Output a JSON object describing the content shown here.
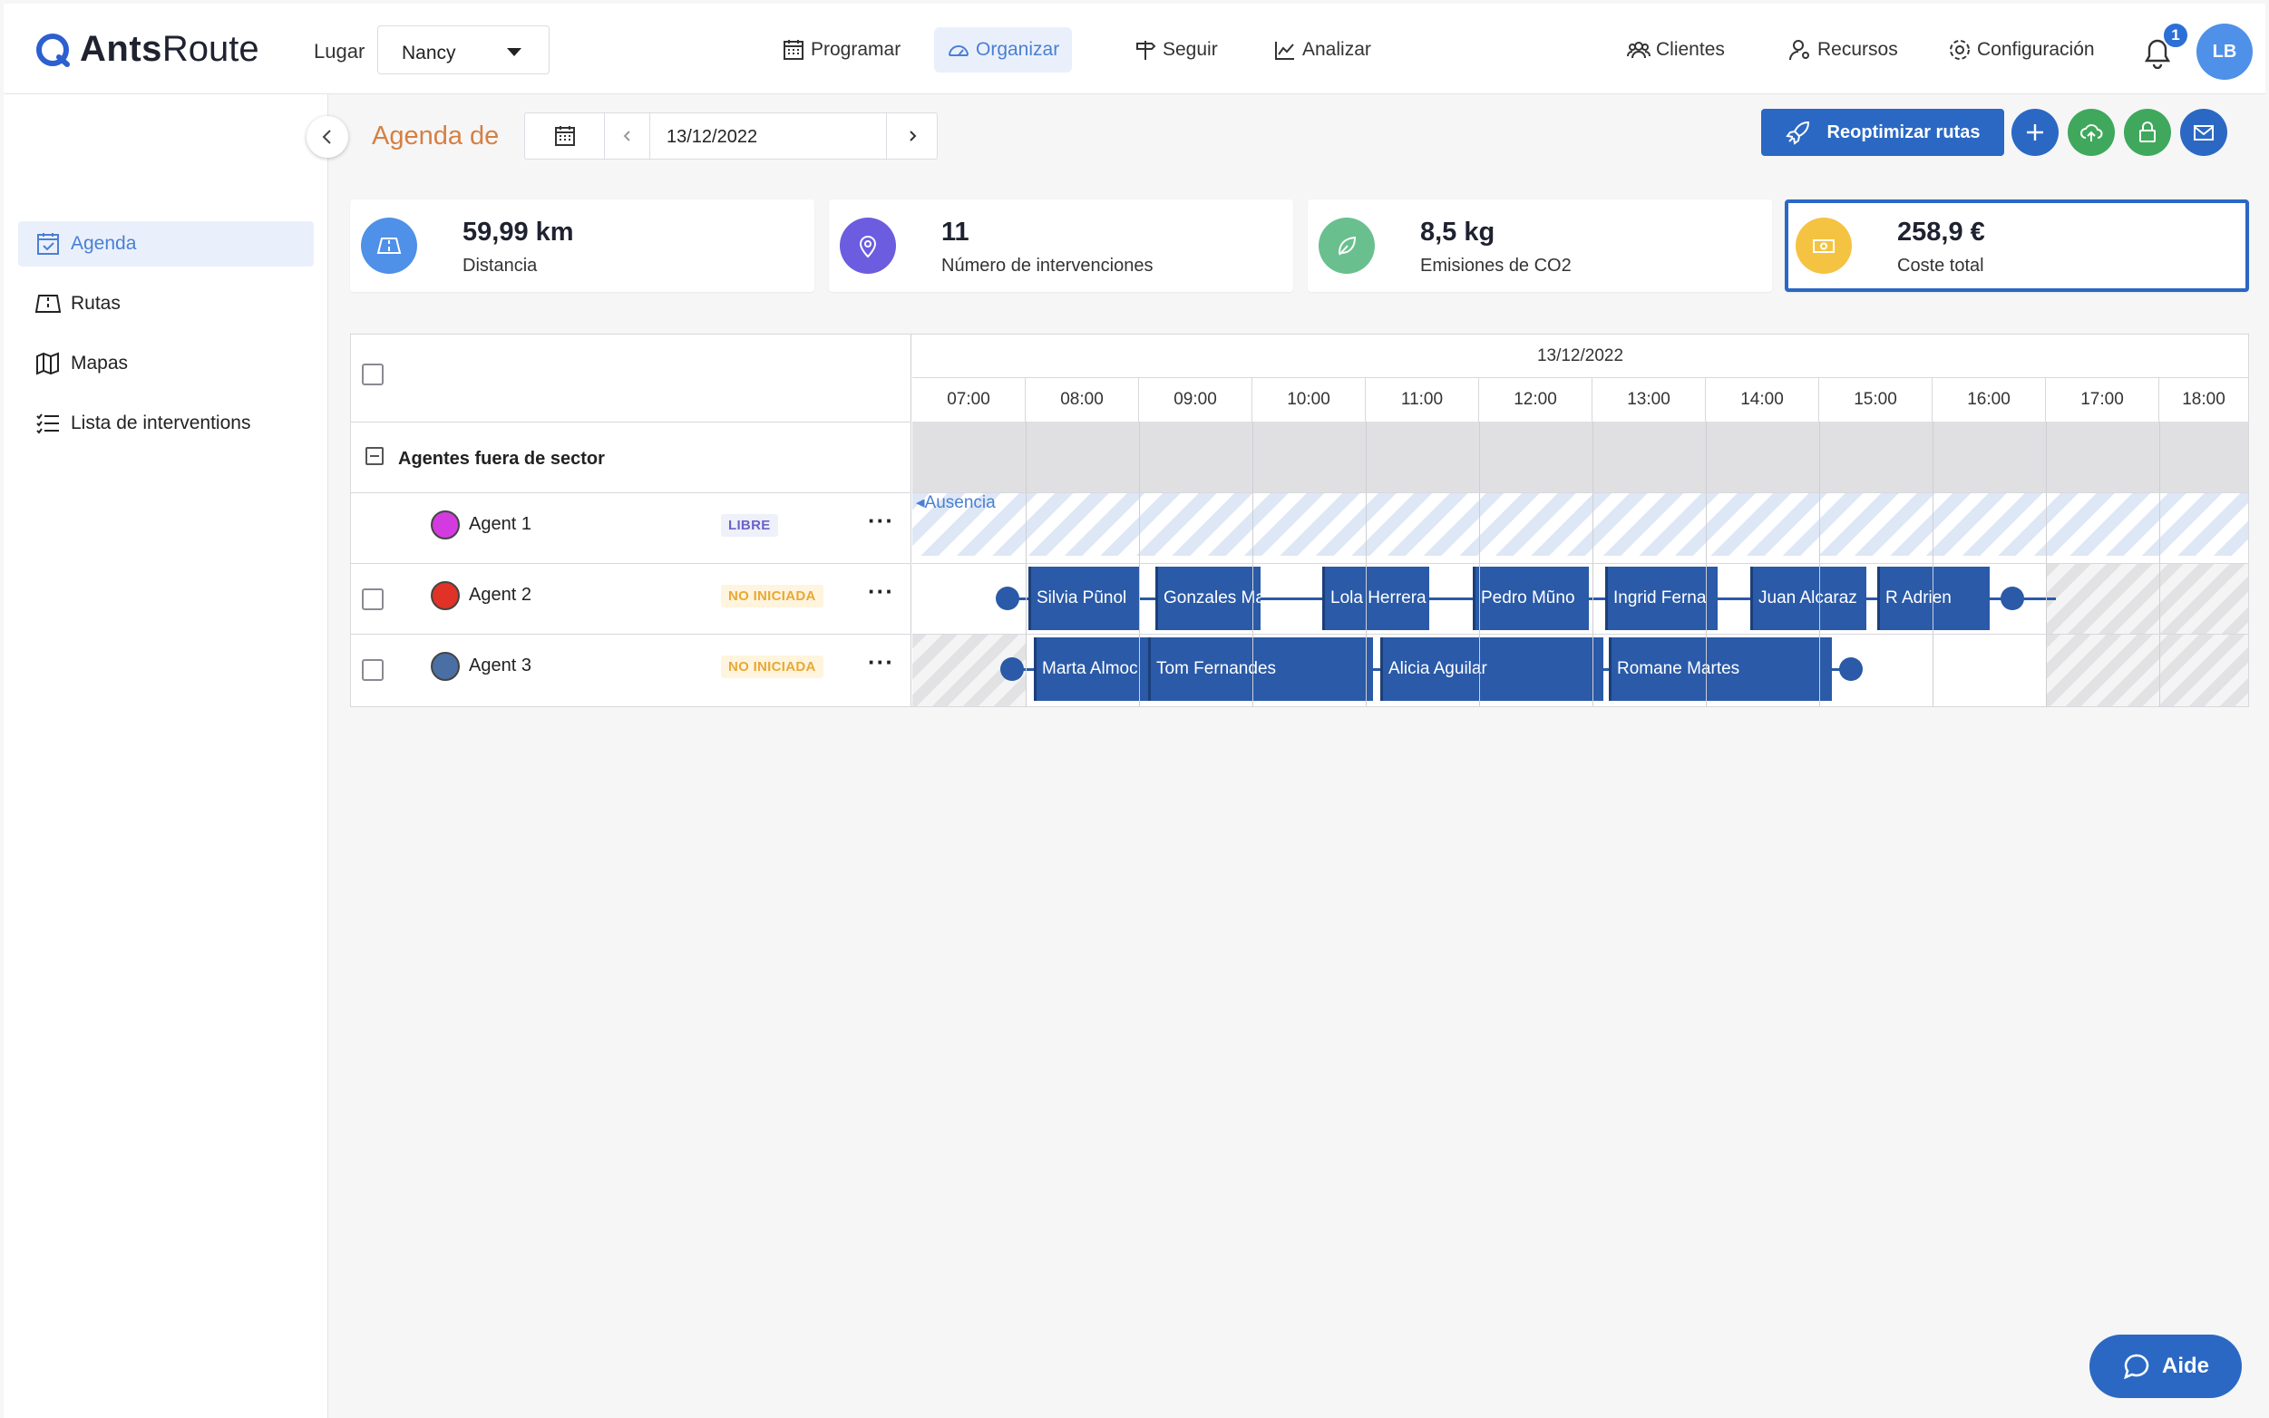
{
  "app": {
    "brand_bold": "Ants",
    "brand_light": "Route"
  },
  "header": {
    "lugar_label": "Lugar",
    "lugar_value": "Nancy",
    "nav": [
      "Programar",
      "Organizar",
      "Seguir",
      "Analizar"
    ],
    "right_nav": [
      "Clientes",
      "Recursos",
      "Configuración"
    ],
    "notifications": "1",
    "user_initials": "LB"
  },
  "sidebar": {
    "items": [
      {
        "label": "Agenda",
        "icon": "calendar-check-icon",
        "active": true
      },
      {
        "label": "Rutas",
        "icon": "route-map-icon"
      },
      {
        "label": "Mapas",
        "icon": "map-icon"
      },
      {
        "label": "Lista de interventions",
        "icon": "list-icon"
      }
    ]
  },
  "toolbar": {
    "title": "Agenda de",
    "date": "13/12/2022",
    "reoptimize_label": "Reoptimizar rutas"
  },
  "stats": [
    {
      "value": "59,99 km",
      "label": "Distancia",
      "icon": "road-icon",
      "color": "#4f90e8"
    },
    {
      "value": "11",
      "label": "Número de intervenciones",
      "icon": "pin-icon",
      "color": "#6b5ce0"
    },
    {
      "value": "8,5 kg",
      "label": "Emisiones de CO2",
      "icon": "leaf-icon",
      "color": "#69c08e"
    },
    {
      "value": "258,9 €",
      "label": "Coste total",
      "icon": "money-icon",
      "color": "#f5c342"
    }
  ],
  "schedule": {
    "date": "13/12/2022",
    "hours": [
      "07:00",
      "08:00",
      "09:00",
      "10:00",
      "11:00",
      "12:00",
      "13:00",
      "14:00",
      "15:00",
      "16:00",
      "17:00",
      "18:00"
    ],
    "group_label": "Agentes fuera de sector",
    "absence_label": "Ausencia",
    "agents": [
      {
        "name": "Agent 1",
        "status": "LIBRE",
        "color": "#d33be0"
      },
      {
        "name": "Agent 2",
        "status": "NO INICIADA",
        "color": "#e03226"
      },
      {
        "name": "Agent 3",
        "status": "NO INICIADA",
        "color": "#4a6fa5"
      }
    ],
    "agent2_tasks": [
      "Silvia Pũnol",
      "Gonzales Ma",
      "Lola Herrera",
      "Pedro Mũno",
      "Ingrid Ferna",
      "Juan Alcaraz",
      "R Adrien"
    ],
    "agent3_tasks": [
      "Marta Almoc",
      "Tom Fernandes",
      "Alicia Aguilar",
      "Romane Martes"
    ]
  },
  "help": {
    "label": "Aide"
  }
}
